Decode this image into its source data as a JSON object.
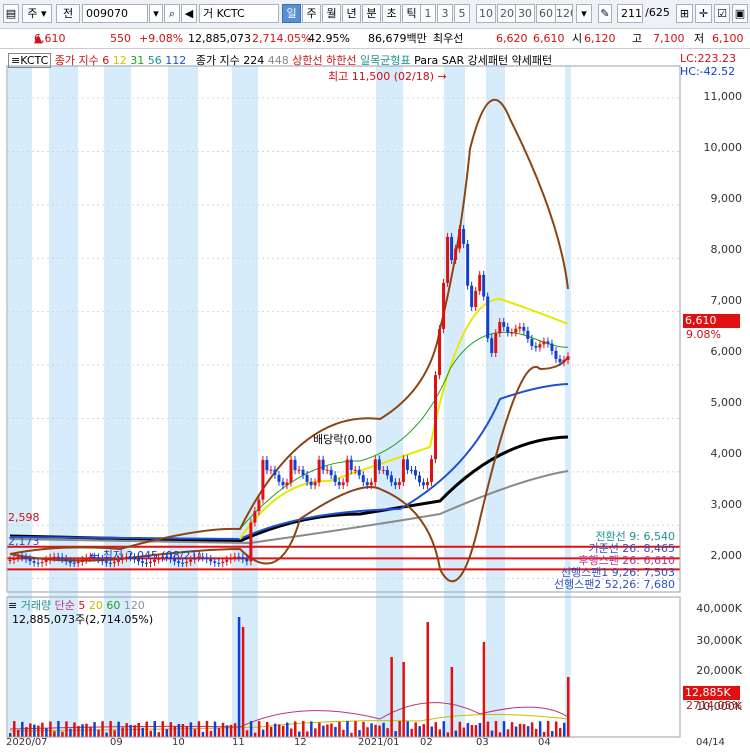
{
  "toolbar": {
    "type_select": "주",
    "period_select": "전",
    "code": "009070",
    "stock_name": "KCTC",
    "period_tabs": [
      "일",
      "주",
      "월",
      "년",
      "분",
      "초",
      "틱"
    ],
    "interval_tabs": [
      "1",
      "3",
      "5",
      "10",
      "20",
      "30",
      "60",
      "120"
    ],
    "count": "211",
    "count_total": "/625"
  },
  "info": {
    "price": "6,610",
    "change": "550",
    "change_pct": "+9.08%",
    "volume": "12,885,073",
    "volume_pct": "2,714.05%",
    "ratio": "42.95%",
    "amount": "86,679백만",
    "best_label": "최우선",
    "ask": "6,620",
    "bid": "6,610",
    "open_label": "시",
    "open": "6,120",
    "high_label": "고",
    "high": "7,100",
    "low_label": "저",
    "low": "6,100"
  },
  "legend": {
    "name": "KCTC",
    "ma_title": "종가 지수",
    "ma_values": [
      "6",
      "12",
      "31",
      "56",
      "112"
    ],
    "ma_colors": [
      "#d01010",
      "#d8c000",
      "#20a020",
      "#209090",
      "#2050d0"
    ],
    "long_ma_title": "종가 지수",
    "long_ma_values": [
      "224",
      "448"
    ],
    "upper_limit": "상한선",
    "lower_limit": "하한선",
    "ichimoku": "일목균형표",
    "parasar": "Para SAR",
    "strong": "강세패턴",
    "weak": "약세패턴",
    "lc": "LC:223.23",
    "hc": "HC:-42.52"
  },
  "annotations": {
    "high_note": "최고 11,500 (02/18)",
    "low_note": "최저 2,045 (08/21)",
    "dividend_note": "배당락(0.00",
    "level_2598": "2,598",
    "level_2173": "2,173",
    "current_price": "6,610",
    "current_pct": "9.08%",
    "right_lines": [
      "전환선 9: 6,540",
      "기준선 26: 8,465",
      "후행스팬 26: 6,610",
      "선행스팬1 9,26: 7,503",
      "선행스팬2 52,26: 7,680"
    ]
  },
  "price_axis": [
    "11,000",
    "10,000",
    "9,000",
    "8,000",
    "7,000",
    "6,000",
    "5,000",
    "4,000",
    "3,000",
    "2,000"
  ],
  "volume_legend": {
    "title": "거래량",
    "ma_title": "단순",
    "ma_values": [
      "5",
      "20",
      "60",
      "120"
    ],
    "ma_colors": [
      "#d01010",
      "#c0c000",
      "#20a020",
      "#9090a0"
    ],
    "value": "12,885,073주(2,714.05%)"
  },
  "volume_axis": [
    "40,000K",
    "30,000K",
    "20,000K",
    "10,000K"
  ],
  "volume_tag": {
    "value": "12,885K",
    "pct": "2714.05%"
  },
  "x_axis": [
    "2020/07",
    "09",
    "10",
    "11",
    "12",
    "2021/01",
    "02",
    "03",
    "04",
    "04/14"
  ],
  "colors": {
    "up": "#e01010",
    "down": "#1040d0",
    "band": "#d6ecfb",
    "accent": "#5a8fd8"
  }
}
